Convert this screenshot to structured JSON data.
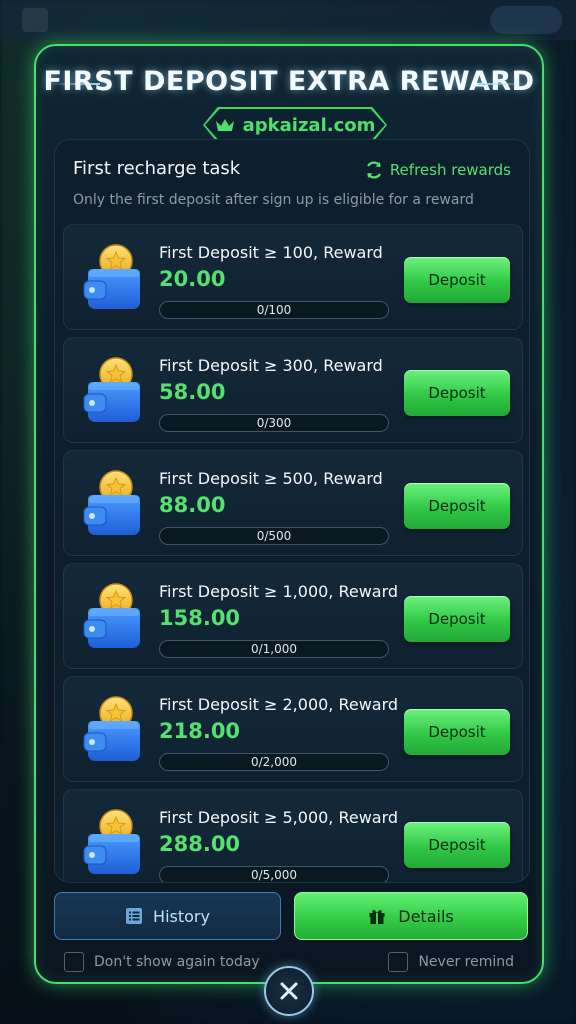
{
  "header": {
    "title": "FIRST DEPOSIT EXTRA REWARD",
    "domain": "apkaizal.com"
  },
  "panel": {
    "title": "First recharge task",
    "refresh_label": "Refresh rewards",
    "subtitle": "Only the first deposit after sign up is eligible for a reward"
  },
  "tasks": [
    {
      "label": "First Deposit ≥ 100, Reward",
      "reward": "20.00",
      "progress_text": "0/100",
      "progress_fraction": 0,
      "button": "Deposit"
    },
    {
      "label": "First Deposit ≥ 300, Reward",
      "reward": "58.00",
      "progress_text": "0/300",
      "progress_fraction": 0,
      "button": "Deposit"
    },
    {
      "label": "First Deposit ≥ 500, Reward",
      "reward": "88.00",
      "progress_text": "0/500",
      "progress_fraction": 0,
      "button": "Deposit"
    },
    {
      "label": "First Deposit ≥ 1,000, Reward",
      "reward": "158.00",
      "progress_text": "0/1,000",
      "progress_fraction": 0,
      "button": "Deposit"
    },
    {
      "label": "First Deposit ≥ 2,000, Reward",
      "reward": "218.00",
      "progress_text": "0/2,000",
      "progress_fraction": 0,
      "button": "Deposit"
    },
    {
      "label": "First Deposit ≥ 5,000, Reward",
      "reward": "288.00",
      "progress_text": "0/5,000",
      "progress_fraction": 0,
      "button": "Deposit"
    }
  ],
  "footer": {
    "history_label": "History",
    "details_label": "Details",
    "dont_show_label": "Don't show again today",
    "never_remind_label": "Never remind"
  },
  "icons": {
    "crown": "crown-icon",
    "refresh": "refresh-icon",
    "wallet": "wallet-coin-icon",
    "history": "list-icon",
    "details": "gift-icon",
    "close": "close-icon"
  },
  "colors": {
    "accent_green": "#55e070",
    "modal_border": "#45e06c",
    "background": "#0d1f2c"
  }
}
